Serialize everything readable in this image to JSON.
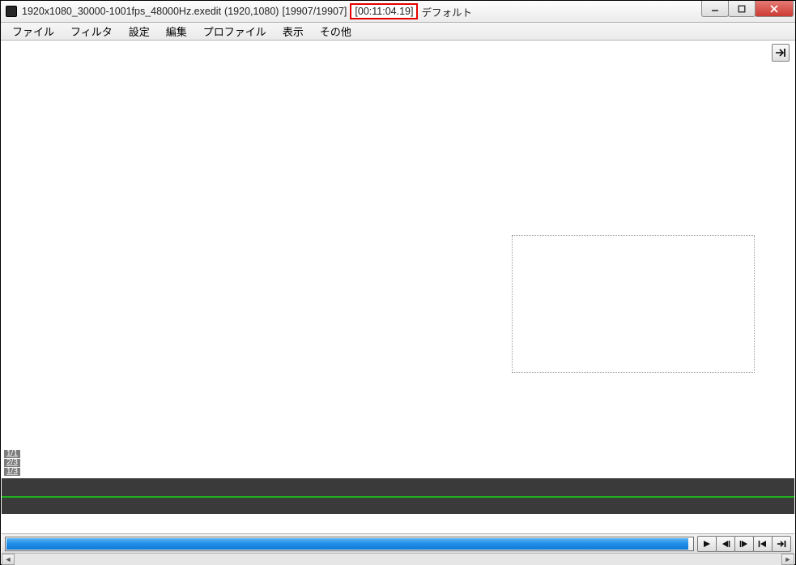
{
  "title": {
    "filename": "1920x1080_30000-1001fps_48000Hz.exedit",
    "resolution": "(1920,1080)",
    "frame_counter": "[19907/19907]",
    "timecode": "[00:11:04.19]",
    "profile": "デフォルト"
  },
  "menu": {
    "items": [
      "ファイル",
      "フィルタ",
      "設定",
      "編集",
      "プロファイル",
      "表示",
      "その他"
    ]
  },
  "layer_marks": [
    "1/1",
    "2/3",
    "1/3"
  ],
  "transport": {
    "play": "▶",
    "step_back": "◀|",
    "step_fwd": "|▶",
    "go_start": "|◀",
    "go_end": "▶|"
  },
  "icons": {
    "jump_end": "→|"
  }
}
